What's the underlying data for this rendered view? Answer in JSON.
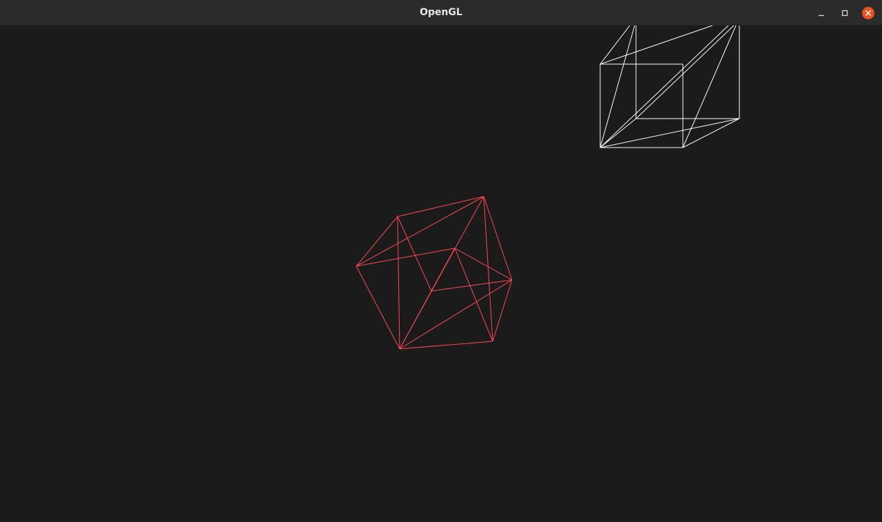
{
  "window": {
    "title": "OpenGL",
    "controls": {
      "minimize": "minimize-icon",
      "maximize": "maximize-icon",
      "close": "close-icon"
    },
    "close_color": "#e95420"
  },
  "scene": {
    "background": "#1b1b1b",
    "objects": [
      {
        "name": "white-wireframe-cube",
        "color": "#ffffff"
      },
      {
        "name": "red-wireframe-cube",
        "color": "#ff4a55"
      }
    ]
  }
}
